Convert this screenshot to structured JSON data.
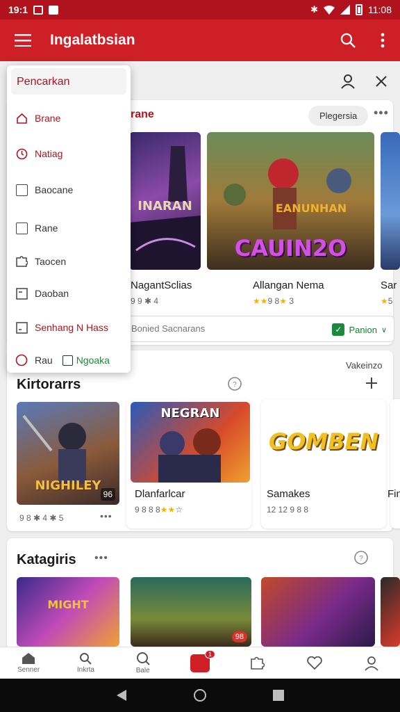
{
  "status": {
    "time": "19:1",
    "right_time": "11:08"
  },
  "appbar": {
    "title": "Ingalatbsian"
  },
  "drawer": {
    "header": "Pencarkan",
    "items": [
      {
        "label": "Brane",
        "icon": "home-icon"
      },
      {
        "label": "Natiag",
        "icon": "clock-icon"
      },
      {
        "label": "Baocane",
        "icon": "checkbox-icon"
      },
      {
        "label": "Rane",
        "icon": "checkbox-icon"
      },
      {
        "label": "Taocen",
        "icon": "puzzle-icon"
      },
      {
        "label": "Daoban",
        "icon": "window-icon"
      },
      {
        "label": "Senhang N Hass",
        "icon": "window-icon"
      },
      {
        "label": "Rau",
        "icon": "circle-icon",
        "extra": "Ngoaka"
      }
    ]
  },
  "section1": {
    "title_partial": "rane",
    "pill": "Plegersia",
    "games": [
      {
        "title": "NagantSclias",
        "rating": "9 9 ✱ 4",
        "art_text": "INARAN"
      },
      {
        "title": "Allangan Nema",
        "rating": "9 8",
        "rating_suffix": "3",
        "art_text": "CAUIN2O",
        "art_text2": "EANUNHAN"
      },
      {
        "title": "Sar",
        "rating": "5"
      }
    ],
    "filter_text": "Bonied Sacnarans",
    "filter_button": "Panion"
  },
  "section2": {
    "title": "Kirtorarrs",
    "right_label": "Vakeinzo",
    "games": [
      {
        "title": "",
        "rating": "9 8 ✱ 4 ✱ 5",
        "art_text": "NIGHILEY",
        "badge": "96"
      },
      {
        "title": "Dlanfarlcar",
        "rating": "9 8 8 8",
        "art_text": "NEGRAN"
      },
      {
        "title": "Samakes",
        "rating": "12 12 9 8 8",
        "art_text": "GOMBEN"
      },
      {
        "title": "Fin",
        "rating": ""
      }
    ]
  },
  "section3": {
    "title": "Katagiris",
    "games": [
      {
        "art_text": "MIGHT"
      },
      {
        "art_text": "",
        "badge": "98"
      },
      {
        "art_text": ""
      },
      {
        "art_text": ""
      }
    ]
  },
  "bottomnav": [
    {
      "label": "Senner",
      "icon": "home-icon"
    },
    {
      "label": "Inkrta",
      "icon": "search-icon"
    },
    {
      "label": "Bale",
      "icon": "search-icon"
    },
    {
      "label": "",
      "icon": "play-icon",
      "badge": "1"
    },
    {
      "label": "",
      "icon": "puzzle-icon"
    },
    {
      "label": "",
      "icon": "heart-icon"
    },
    {
      "label": "",
      "icon": "profile-icon"
    }
  ],
  "colors": {
    "brand": "#cf1f26",
    "status": "#b0131d",
    "accent_green": "#1b8a3a"
  }
}
